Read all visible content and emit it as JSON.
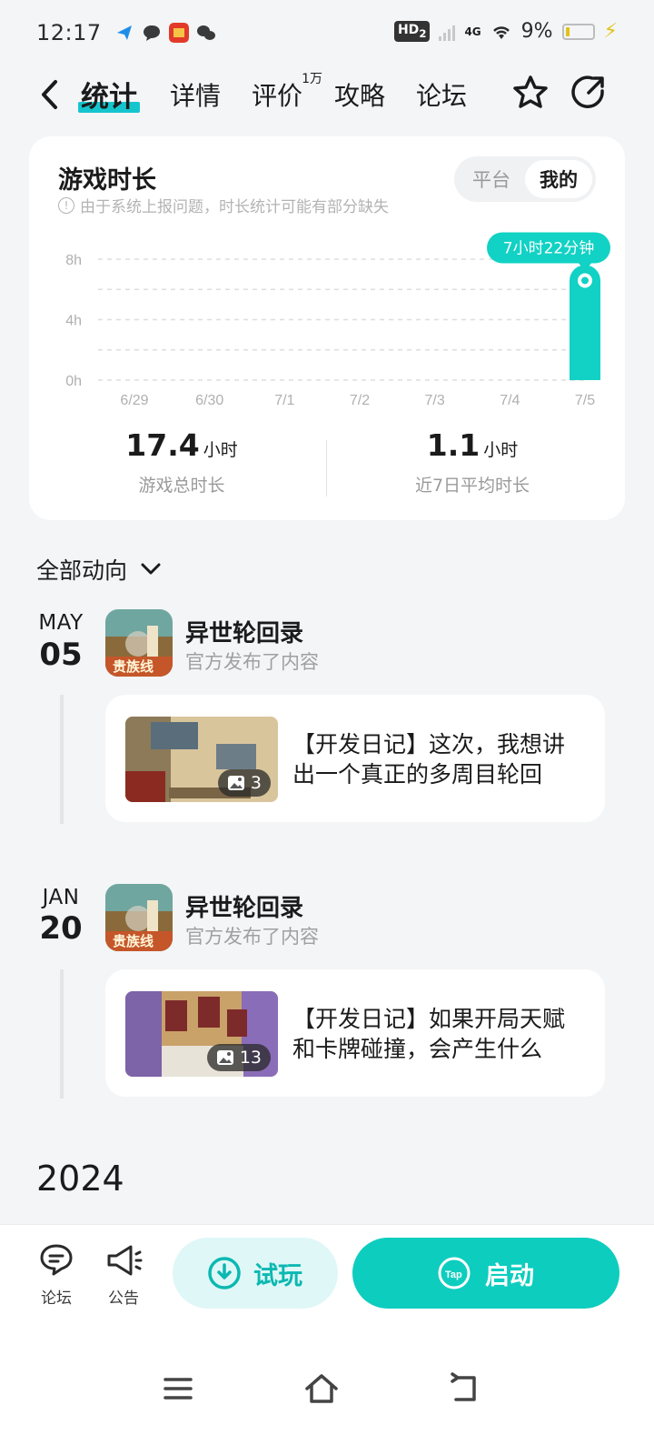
{
  "status": {
    "time": "12:17",
    "hd": "HD",
    "hd_sub": "2",
    "network": "4G",
    "battery": "9%"
  },
  "nav": {
    "tabs": [
      {
        "label": "统计"
      },
      {
        "label": "详情"
      },
      {
        "label": "评价",
        "badge": "1万"
      },
      {
        "label": "攻略"
      },
      {
        "label": "论坛"
      }
    ]
  },
  "stats": {
    "title": "游戏时长",
    "note": "由于系统上报问题，时长统计可能有部分缺失",
    "segments": [
      "平台",
      "我的"
    ],
    "summary": [
      {
        "value": "17.4",
        "unit": "小时",
        "label": "游戏总时长"
      },
      {
        "value": "1.1",
        "unit": "小时",
        "label": "近7日平均时长"
      }
    ]
  },
  "chart_data": {
    "type": "bar",
    "categories": [
      "6/29",
      "6/30",
      "7/1",
      "7/2",
      "7/3",
      "7/4",
      "7/5"
    ],
    "values": [
      0,
      0,
      0,
      0,
      0,
      0,
      7.37
    ],
    "ytick_labels": [
      "0h",
      "4h",
      "8h"
    ],
    "yticks": [
      0,
      4,
      8
    ],
    "ylim": [
      0,
      8
    ],
    "highlight_label": "7小时22分钟",
    "color": "#11d2c4"
  },
  "activity": {
    "filter_label": "全部动向",
    "posts": [
      {
        "month": "MAY",
        "day": "05",
        "game": "异世轮回录",
        "action": "官方发布了内容",
        "title": "【开发日记】这次，我想讲出一个真正的多周目轮回",
        "images": "3",
        "icon_text": "贵族线"
      },
      {
        "month": "JAN",
        "day": "20",
        "game": "异世轮回录",
        "action": "官方发布了内容",
        "title": "【开发日记】如果开局天赋和卡牌碰撞，会产生什么",
        "images": "13",
        "icon_text": "贵族线"
      }
    ],
    "year_label": "2024"
  },
  "bottom": {
    "forum": "论坛",
    "notice": "公告",
    "trial": "试玩",
    "launch": "启动",
    "tap_text": "Tap"
  }
}
